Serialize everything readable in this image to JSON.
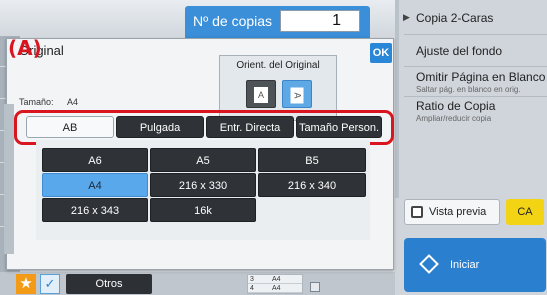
{
  "header": {
    "copies_label": "Nº de copias",
    "copies_value": "1"
  },
  "right_menu": {
    "items": [
      {
        "label": "Copia 2-Caras",
        "sub": ""
      },
      {
        "label": "Ajuste del fondo",
        "sub": ""
      },
      {
        "label": "Omitir Página en Blanco",
        "sub": "Saltar pág. en blanco en orig."
      },
      {
        "label": "Ratio de Copia",
        "sub": "Ampliar/reducir copia"
      }
    ],
    "preview_label": "Vista previa",
    "ca_label": "CA",
    "start_label": "Iniciar"
  },
  "dialog": {
    "title": "Original",
    "ok_label": "OK",
    "size_label": "Tamaño:",
    "size_value": "A4",
    "orientation_title": "Orient. del Original",
    "orientation_portrait_glyph": "A",
    "orientation_landscape_glyph": "A",
    "callout": "(A)",
    "tabs": [
      "AB",
      "Pulgada",
      "Entr. Directa",
      "Tamaño Person."
    ],
    "active_tab": "AB",
    "sizes": [
      "A6",
      "A5",
      "B5",
      "A4",
      "216 x 330",
      "216 x 340",
      "216 x 343",
      "16k"
    ],
    "selected_size": "A4"
  },
  "bottom": {
    "otros_label": "Otros",
    "star_glyph": "★",
    "check_glyph": "✓",
    "mini_rows": [
      {
        "num": "3",
        "size": "A4"
      },
      {
        "num": "4",
        "size": "A4"
      }
    ]
  },
  "colors": {
    "accent_blue": "#2a86d6",
    "highlight_red": "#d9151f",
    "ca_yellow": "#f2d414",
    "star_orange": "#f39a16"
  }
}
